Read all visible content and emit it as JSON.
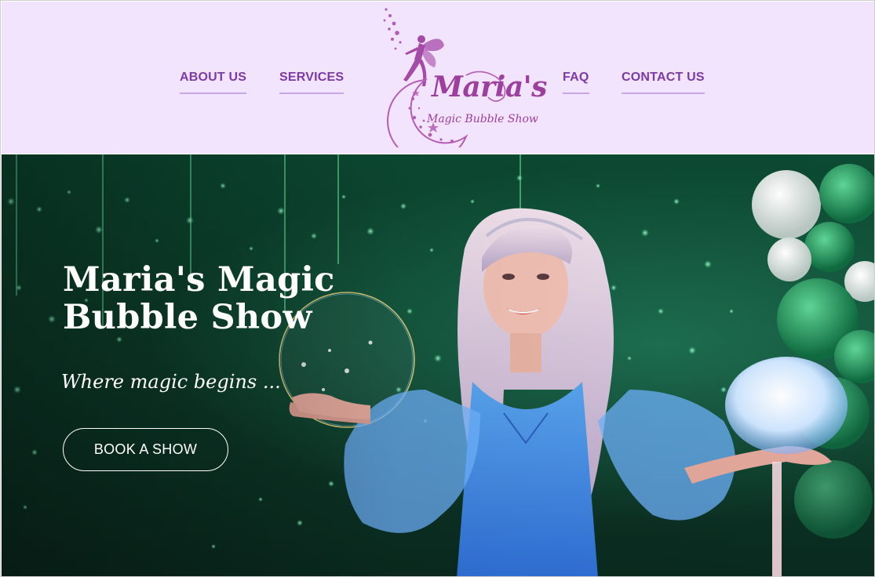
{
  "nav": {
    "left": [
      {
        "label": "ABOUT US"
      },
      {
        "label": "SERVICES"
      }
    ],
    "right": [
      {
        "label": "FAQ"
      },
      {
        "label": "CONTACT US"
      }
    ]
  },
  "logo": {
    "title": "Maria's",
    "subtitle": "Magic Bubble Show",
    "icon": "fairy-moon-logo-icon"
  },
  "hero": {
    "title": "Maria's Magic Bubble Show",
    "tagline": "Where magic begins ...",
    "cta_label": "BOOK A SHOW",
    "image": "performer-holding-bubbles-photo"
  },
  "colors": {
    "header_bg": "#f2e4fd",
    "nav_text": "#7c3aa6",
    "nav_underline": "#c9a6e6",
    "logo_accent": "#9c3f9e",
    "hero_bg": "#0d3f2c",
    "hero_text": "#ffffff"
  }
}
